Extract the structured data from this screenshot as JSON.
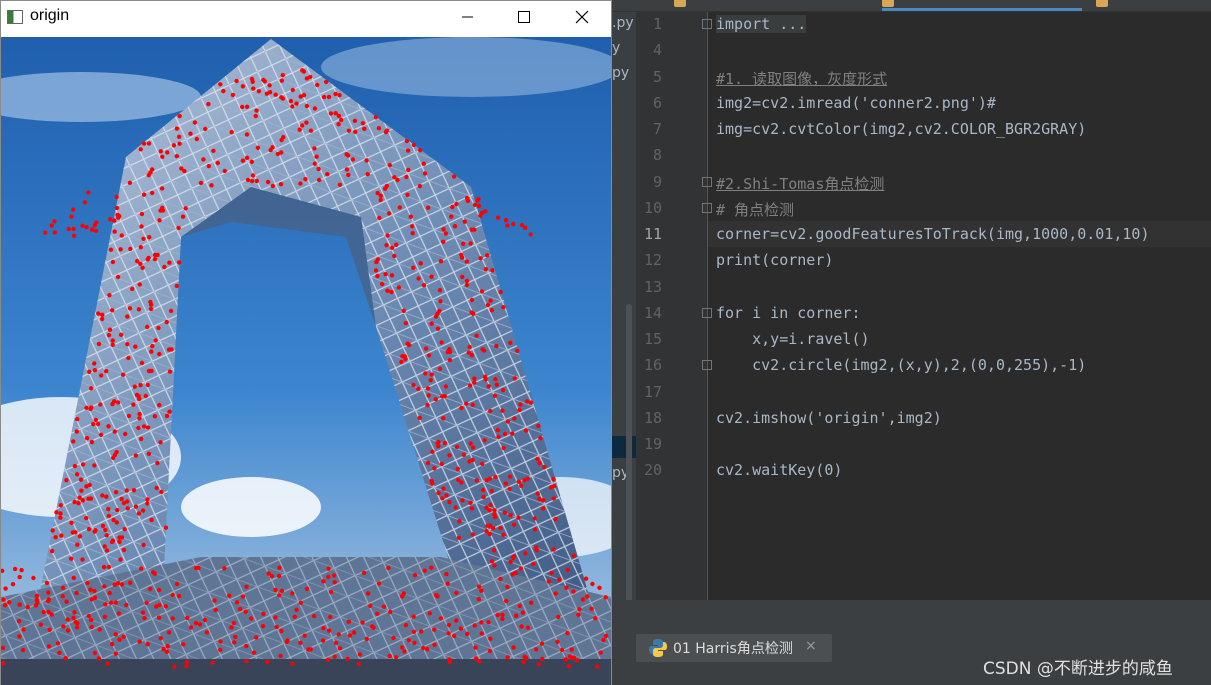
{
  "cv_window": {
    "title": "origin",
    "icon": "opencv-window-icon",
    "controls": [
      "minimize-icon",
      "maximize-icon",
      "close-icon"
    ],
    "image": {
      "description_icon": "cctv-building-photo",
      "corner_marker_color": "#ff0000",
      "sky_color": "#2d6fc0",
      "building_color": "#8ea6c8"
    }
  },
  "ide": {
    "project_stub": [
      ".py",
      "y",
      "py",
      "py"
    ],
    "current_line": "11",
    "lines": [
      {
        "num": "1",
        "code": "import ..."
      },
      {
        "num": "4",
        "code": ""
      },
      {
        "num": "5",
        "code": "#1. 读取图像，灰度形式"
      },
      {
        "num": "6",
        "code": "img2=cv2.imread('conner2.png')#"
      },
      {
        "num": "7",
        "code": "img=cv2.cvtColor(img2,cv2.COLOR_BGR2GRAY)"
      },
      {
        "num": "8",
        "code": ""
      },
      {
        "num": "9",
        "code": "#2.Shi-Tomas角点检测"
      },
      {
        "num": "10",
        "code": "# 角点检测"
      },
      {
        "num": "11",
        "code": "corner=cv2.goodFeaturesToTrack(img,1000,0.01,10)"
      },
      {
        "num": "12",
        "code": "print(corner)"
      },
      {
        "num": "13",
        "code": ""
      },
      {
        "num": "14",
        "code": "for i in corner:"
      },
      {
        "num": "15",
        "code": "    x,y=i.ravel()"
      },
      {
        "num": "16",
        "code": "    cv2.circle(img2,(x,y),2,(0,0,255),-1)"
      },
      {
        "num": "17",
        "code": ""
      },
      {
        "num": "18",
        "code": "cv2.imshow('origin',img2)"
      },
      {
        "num": "19",
        "code": ""
      },
      {
        "num": "20",
        "code": "cv2.waitKey(0)"
      }
    ],
    "run_tab": {
      "label": "01 Harris角点检测",
      "icon": "python-icon",
      "close": "×"
    },
    "watermark": "CSDN @不断进步的咸鱼"
  }
}
